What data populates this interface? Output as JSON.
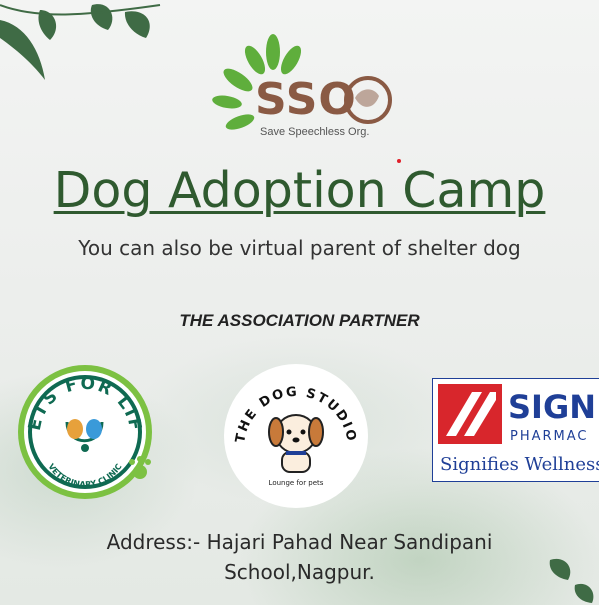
{
  "logo": {
    "word": "SSO",
    "tagline": "Save Speechless Org."
  },
  "title": "Dog Adoption Camp",
  "subtitle": "You can also be virtual parent of shelter dog",
  "partner_heading": "THE ASSOCIATION PARTNER",
  "partners": {
    "vets_for_life": {
      "name": "VETS FOR LIFE",
      "sub": "VETERINARY CLINIC"
    },
    "dog_studio": {
      "name": "THE DOG STUDIO",
      "tagline": "Lounge for pets"
    },
    "signature": {
      "name": "SIGN",
      "sub": "PHARMAC",
      "tagline": "Signifies Wellness"
    }
  },
  "address": {
    "line1": "Address:- Hajari Pahad Near Sandipani",
    "line2": "School,Nagpur."
  },
  "colors": {
    "title": "#2f5a2f",
    "logo_brown": "#8a5a44",
    "leaf_green": "#5fae3c",
    "signature_blue": "#1f3f97",
    "signature_red": "#d8262c"
  },
  "icons": [
    "leaf-decoration-icon",
    "dog-face-icon",
    "paw-icon",
    "stethoscope-icon"
  ]
}
